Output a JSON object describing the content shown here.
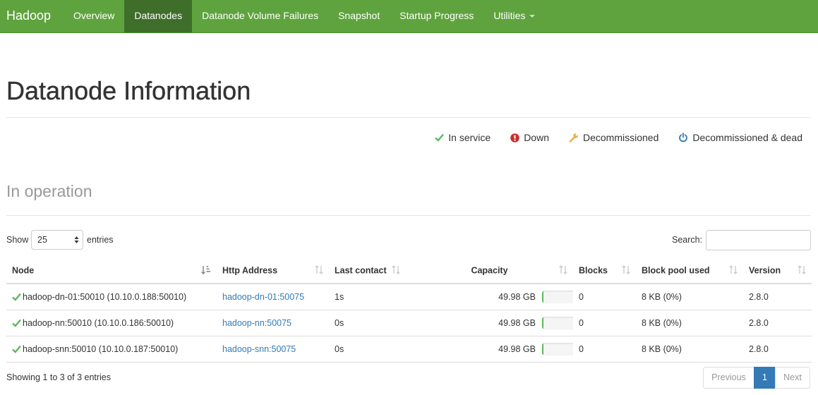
{
  "navbar": {
    "brand": "Hadoop",
    "items": [
      {
        "label": "Overview"
      },
      {
        "label": "Datanodes"
      },
      {
        "label": "Datanode Volume Failures"
      },
      {
        "label": "Snapshot"
      },
      {
        "label": "Startup Progress"
      },
      {
        "label": "Utilities"
      }
    ],
    "active": "Datanodes",
    "color": "#5fa33e",
    "active_color": "#3e6e2a"
  },
  "page": {
    "title": "Datanode Information",
    "section_title": "In operation"
  },
  "legend": [
    {
      "label": "In service",
      "icon": "check-icon",
      "color": "#5cb85c"
    },
    {
      "label": "Down",
      "icon": "exclamation-circle-icon",
      "color": "#c9302c"
    },
    {
      "label": "Decommissioned",
      "icon": "wrench-icon",
      "color": "#f0ad4e"
    },
    {
      "label": "Decommissioned & dead",
      "icon": "power-icon",
      "color": "#337ab7"
    }
  ],
  "table_controls": {
    "show_label": "Show",
    "page_length": "25",
    "entries_label": "entries",
    "search_label": "Search:",
    "search_value": ""
  },
  "table": {
    "columns": [
      "Node",
      "Http Address",
      "Last contact",
      "Capacity",
      "Blocks",
      "Block pool used",
      "Version"
    ],
    "rows": [
      {
        "node": "hadoop-dn-01:50010 (10.10.0.188:50010)",
        "http": "hadoop-dn-01:50075",
        "last_contact": "1s",
        "capacity": "49.98 GB",
        "capacity_used_fraction": 0.02,
        "blocks": "0",
        "block_pool_used": "8 KB (0%)",
        "version": "2.8.0",
        "status": "in-service"
      },
      {
        "node": "hadoop-nn:50010 (10.10.0.186:50010)",
        "http": "hadoop-nn:50075",
        "last_contact": "0s",
        "capacity": "49.98 GB",
        "capacity_used_fraction": 0.02,
        "blocks": "0",
        "block_pool_used": "8 KB (0%)",
        "version": "2.8.0",
        "status": "in-service"
      },
      {
        "node": "hadoop-snn:50010 (10.10.0.187:50010)",
        "http": "hadoop-snn:50075",
        "last_contact": "0s",
        "capacity": "49.98 GB",
        "capacity_used_fraction": 0.02,
        "blocks": "0",
        "block_pool_used": "8 KB (0%)",
        "version": "2.8.0",
        "status": "in-service"
      }
    ]
  },
  "footer": {
    "info": "Showing 1 to 3 of 3 entries",
    "previous": "Previous",
    "page": "1",
    "next": "Next"
  }
}
